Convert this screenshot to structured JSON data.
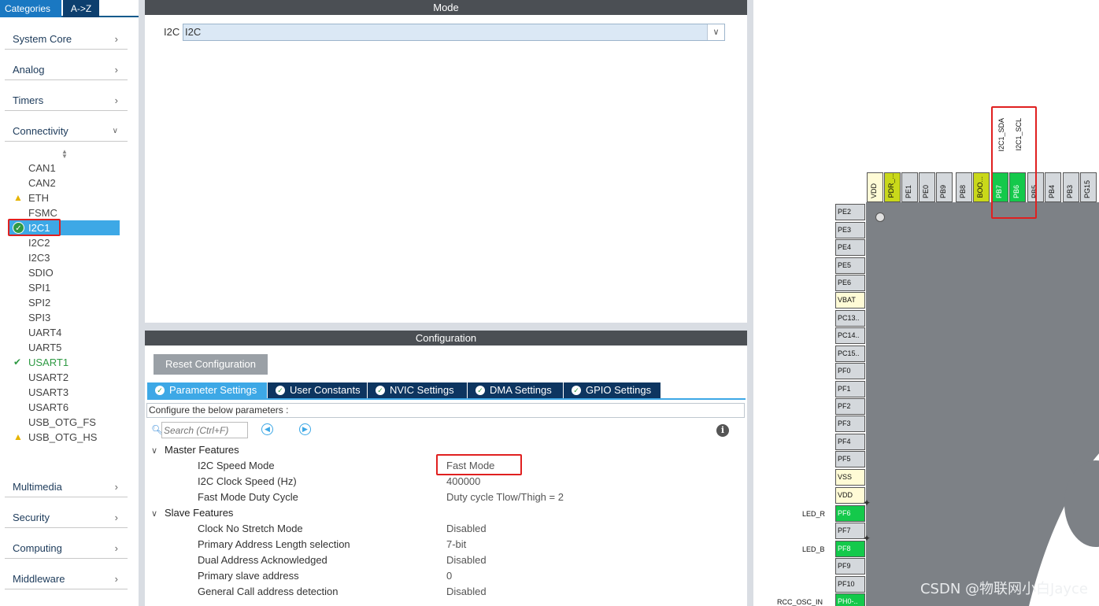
{
  "sidebar": {
    "tabs": {
      "categories": "Categories",
      "az": "A->Z"
    },
    "categories": {
      "system_core": "System Core",
      "analog": "Analog",
      "timers": "Timers",
      "connectivity": "Connectivity",
      "multimedia": "Multimedia",
      "security": "Security",
      "computing": "Computing",
      "middleware": "Middleware"
    },
    "peripherals": {
      "can1": "CAN1",
      "can2": "CAN2",
      "eth": "ETH",
      "fsmc": "FSMC",
      "i2c1": "I2C1",
      "i2c2": "I2C2",
      "i2c3": "I2C3",
      "sdio": "SDIO",
      "spi1": "SPI1",
      "spi2": "SPI2",
      "spi3": "SPI3",
      "uart4": "UART4",
      "uart5": "UART5",
      "usart1": "USART1",
      "usart2": "USART2",
      "usart3": "USART3",
      "usart6": "USART6",
      "usb_otg_fs": "USB_OTG_FS",
      "usb_otg_hs": "USB_OTG_HS"
    }
  },
  "mode": {
    "title": "Mode",
    "field_label": "I2C",
    "field_value": "I2C"
  },
  "configuration": {
    "title": "Configuration",
    "reset_button": "Reset Configuration",
    "tabs": {
      "parameter": "Parameter Settings",
      "user_constants": "User Constants",
      "nvic": "NVIC Settings",
      "dma": "DMA Settings",
      "gpio": "GPIO Settings"
    },
    "description": "Configure the below parameters :",
    "search_placeholder": "Search (Ctrl+F)",
    "master_group": "Master Features",
    "slave_group": "Slave Features",
    "params": {
      "speed_mode": {
        "name": "I2C Speed Mode",
        "value": "Fast Mode"
      },
      "clock_speed": {
        "name": "I2C Clock Speed (Hz)",
        "value": "400000"
      },
      "duty_cycle": {
        "name": "Fast Mode Duty Cycle",
        "value": "Duty cycle Tlow/Thigh = 2"
      },
      "no_stretch": {
        "name": "Clock No Stretch Mode",
        "value": "Disabled"
      },
      "addr_len": {
        "name": "Primary Address Length selection",
        "value": "7-bit"
      },
      "dual_addr": {
        "name": "Dual Address Acknowledged",
        "value": "Disabled"
      },
      "primary_addr": {
        "name": "Primary slave address",
        "value": "0"
      },
      "general_call": {
        "name": "General Call address detection",
        "value": "Disabled"
      }
    }
  },
  "chip": {
    "top_pins": {
      "vdd": "VDD",
      "pdr": "PDR_...",
      "pe1": "PE1",
      "pe0": "PE0",
      "pb9": "PB9",
      "pb8": "PB8",
      "boot": "BOO...",
      "pb7": "PB7",
      "pb6": "PB6",
      "pb5": "PB5",
      "pb4": "PB4",
      "pb3": "PB3",
      "pg15": "PG15"
    },
    "top_labels": {
      "pb7": "I2C1_SDA",
      "pb6": "I2C1_SCL"
    },
    "left_pins": {
      "pe2": "PE2",
      "pe3": "PE3",
      "pe4": "PE4",
      "pe5": "PE5",
      "pe6": "PE6",
      "vbat": "VBAT",
      "pc13": "PC13..",
      "pc14": "PC14..",
      "pc15": "PC15..",
      "pf0": "PF0",
      "pf1": "PF1",
      "pf2": "PF2",
      "pf3": "PF3",
      "pf4": "PF4",
      "pf5": "PF5",
      "vss": "VSS",
      "vdd": "VDD",
      "pf6": "PF6",
      "pf7": "PF7",
      "pf8": "PF8",
      "pf9": "PF9",
      "pf10": "PF10",
      "ph0": "PH0-.."
    },
    "left_labels": {
      "pf6": "LED_R",
      "pf8": "LED_B",
      "ph0": "RCC_OSC_IN"
    }
  },
  "watermark": "CSDN @物联网小白Jayce",
  "colors": {
    "selected": "#3da8e6",
    "ok": "#2f9a44",
    "warning": "#e6b400",
    "pin_assigned": "#14c94b",
    "highlight": "#e02020"
  }
}
